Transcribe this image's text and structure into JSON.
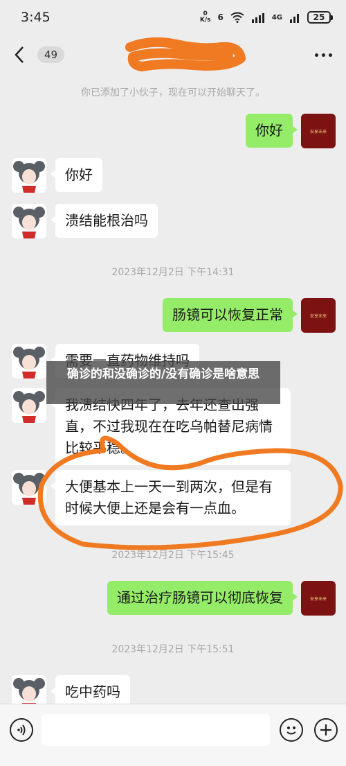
{
  "status_bar": {
    "time": "3:45",
    "net_speed_value": "0",
    "net_speed_unit": "K/s",
    "signal_label": "4G",
    "battery": "25"
  },
  "header": {
    "unread_count": "49",
    "contact_name": ""
  },
  "messages": [
    {
      "type": "system",
      "text": "你已添加了小伙子，现在可以开始聊天了。"
    },
    {
      "type": "me",
      "text": "你好"
    },
    {
      "type": "other",
      "text": "你好"
    },
    {
      "type": "other",
      "text": "溃结能根治吗"
    },
    {
      "type": "system",
      "text": "2023年12月2日 下午14:31"
    },
    {
      "type": "me",
      "text": "肠镜可以恢复正常"
    },
    {
      "type": "other",
      "text": "需要一直药物维持吗"
    },
    {
      "type": "other",
      "text": "我溃结快四年了，去年还查出强直，不过我现在在吃乌帕替尼病情比较平稳。"
    },
    {
      "type": "other",
      "text": "大便基本上一天一到两次，但是有时候大便上还是会有一点血。"
    },
    {
      "type": "system",
      "text": "2023年12月2日 下午15:45"
    },
    {
      "type": "me",
      "text": "通过治疗肠镜可以彻底恢复"
    },
    {
      "type": "system",
      "text": "2023年12月2日 下午15:51"
    },
    {
      "type": "other",
      "text": "吃中药吗"
    }
  ],
  "my_avatar_text": "安享未来",
  "overlay_banner": "确诊的和没确诊的/没有确诊是啥意思",
  "input_bar": {
    "placeholder": ""
  },
  "colors": {
    "my_bubble": "#95ec69",
    "other_bubble": "#ffffff",
    "background": "#ededed",
    "annotation_stroke": "#f07a22"
  }
}
